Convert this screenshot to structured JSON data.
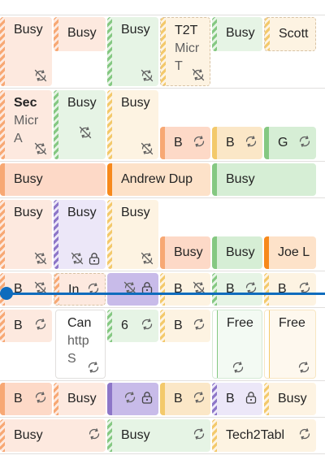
{
  "labels": {
    "busy": "Busy",
    "t2t": "T2T",
    "scott": "Scott",
    "micr": "Micr",
    "t": "T",
    "a": "A",
    "sec": "Sec",
    "b_trunc": "B",
    "g_trunc": "G",
    "andrew": "Andrew Dup",
    "joe": "Joe L",
    "in_trunc": "In",
    "sixty": "6",
    "free": "Free",
    "can": "Can",
    "http": "http",
    "s": "S",
    "tech2": "Tech2Tabl"
  },
  "colors": {
    "now_indicator": "#0f6cbd",
    "grid_line": "#e1dfdd"
  },
  "icons": {
    "sync_disabled": "sync-disabled-icon",
    "sync": "sync-icon",
    "lock": "lock-icon"
  }
}
